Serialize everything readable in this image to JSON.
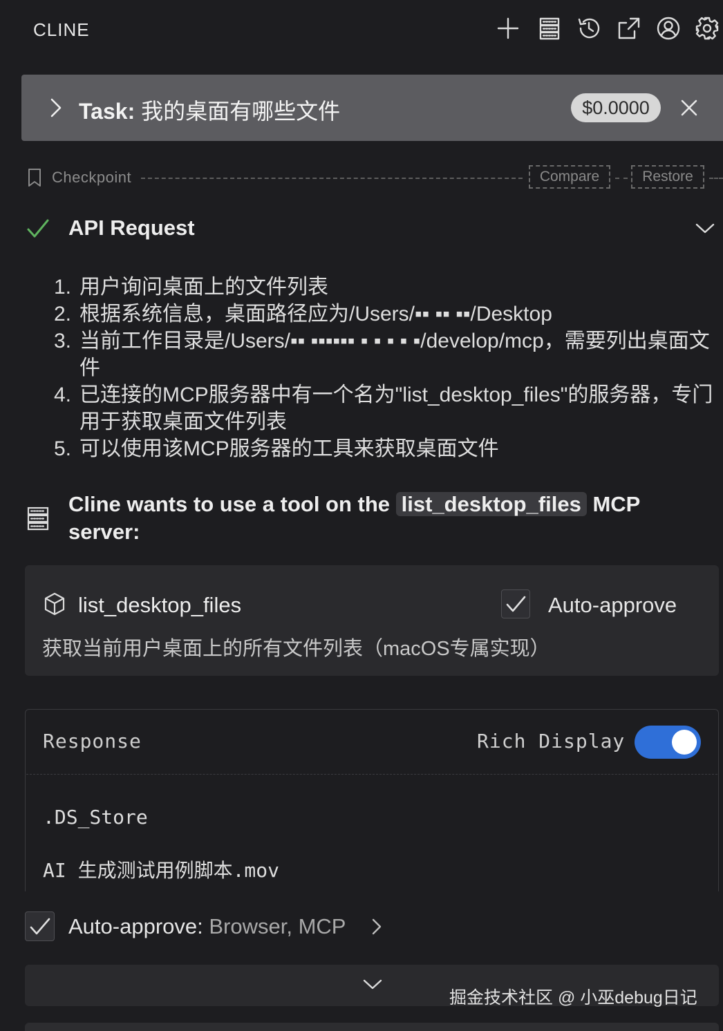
{
  "header": {
    "app_title": "CLINE",
    "icons": [
      "plus-icon",
      "server-icon",
      "history-icon",
      "popout-icon",
      "account-icon",
      "gear-icon"
    ]
  },
  "task": {
    "prefix": "Task:",
    "text": "我的桌面有哪些文件",
    "cost": "$0.0000"
  },
  "checkpoint": {
    "label": "Checkpoint",
    "compare_label": "Compare",
    "restore_label": "Restore"
  },
  "api_request": {
    "title": "API Request",
    "status_color": "#5fb35f",
    "reasoning": [
      {
        "num": "1.",
        "text": "用户询问桌面上的文件列表"
      },
      {
        "num": "2.",
        "text": "根据系统信息，桌面路径应为/Users/▪▪ ▪▪ ▪▪/Desktop"
      },
      {
        "num": "3.",
        "text": "当前工作目录是/Users/▪▪ ▪▪▪▪▪▪ ▪ ▪ ▪ ▪ ▪/develop/mcp，需要列出桌面文件"
      },
      {
        "num": "4.",
        "text": "已连接的MCP服务器中有一个名为\"list_desktop_files\"的服务器，专门用于获取桌面文件列表"
      },
      {
        "num": "5.",
        "text": "可以使用该MCP服务器的工具来获取桌面文件"
      }
    ]
  },
  "tool_request": {
    "heading_prefix": "Cline wants to use a tool on the",
    "server_name": "list_desktop_files",
    "heading_suffix": "MCP server:",
    "tool_name": "list_desktop_files",
    "auto_approve_label": "Auto-approve",
    "description": "获取当前用户桌面上的所有文件列表（macOS专属实现）"
  },
  "response": {
    "label": "Response",
    "rich_display_label": "Rich Display",
    "rich_display_on": true,
    "accent": "#2f6fd8",
    "lines": [
      ".DS_Store",
      "AI 生成测试用例脚本.mov"
    ]
  },
  "auto_approve_bar": {
    "label": "Auto-approve:",
    "value": "Browser, MCP"
  },
  "watermark": "掘金技术社区 @ 小巫debug日记"
}
